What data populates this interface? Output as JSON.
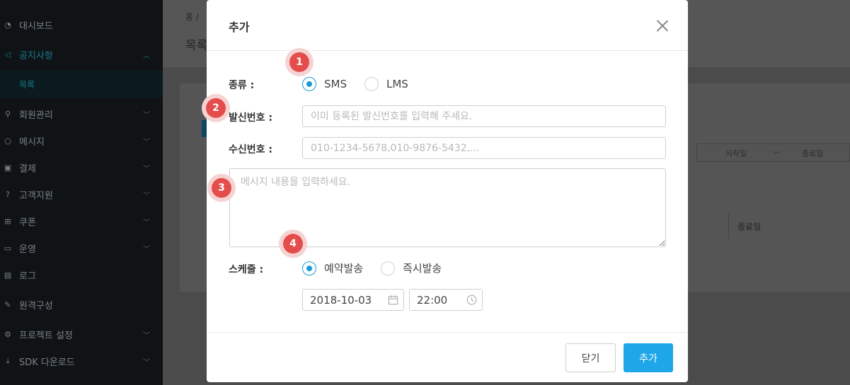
{
  "sidebar": {
    "items": [
      {
        "label": "대시보드",
        "icon": "gauge-icon",
        "chevron": false
      },
      {
        "label": "공지사항",
        "icon": "megaphone-icon",
        "chevron": true,
        "expanded": true
      },
      {
        "label": "회원관리",
        "icon": "user-icon",
        "chevron": true
      },
      {
        "label": "메시지",
        "icon": "chat-icon",
        "chevron": true
      },
      {
        "label": "결제",
        "icon": "payment-icon",
        "chevron": true
      },
      {
        "label": "고객지원",
        "icon": "help-icon",
        "chevron": true
      },
      {
        "label": "쿠폰",
        "icon": "gift-icon",
        "chevron": true
      },
      {
        "label": "운영",
        "icon": "monitor-icon",
        "chevron": true
      },
      {
        "label": "로그",
        "icon": "log-icon",
        "chevron": false
      },
      {
        "label": "원격구성",
        "icon": "wrench-icon",
        "chevron": false
      },
      {
        "label": "프로젝트 설정",
        "icon": "gear-icon",
        "chevron": true
      },
      {
        "label": "SDK 다운로드",
        "icon": "download-icon",
        "chevron": true
      }
    ],
    "active_sub": "목록"
  },
  "background": {
    "breadcrumb": "홈 /",
    "page_title": "목록",
    "date_start": "시작일",
    "date_sep": "~",
    "date_end": "종료일",
    "col_end": "종료일"
  },
  "modal": {
    "title": "추가",
    "type_label": "종류 :",
    "type_options": [
      "SMS",
      "LMS"
    ],
    "type_selected": "SMS",
    "sender_label": "발신번호 :",
    "sender_placeholder": "이미 등록된 발신번호를 입력해 주세요.",
    "receiver_label": "수신번호 :",
    "receiver_placeholder": "010-1234-5678,010-9876-5432,...",
    "message_placeholder": "메시지 내용을 입력하세요.",
    "schedule_label": "스케줄 :",
    "schedule_options": [
      "예약발송",
      "즉시발송"
    ],
    "schedule_selected": "예약발송",
    "date_value": "2018-10-03",
    "time_value": "22:00",
    "close_button": "닫기",
    "add_button": "추가"
  },
  "annotations": [
    "1",
    "2",
    "3",
    "4"
  ],
  "colors": {
    "accent": "#1ea7e8",
    "badge": "#e54c4c",
    "sidebar_active": "#1a7a8a"
  }
}
